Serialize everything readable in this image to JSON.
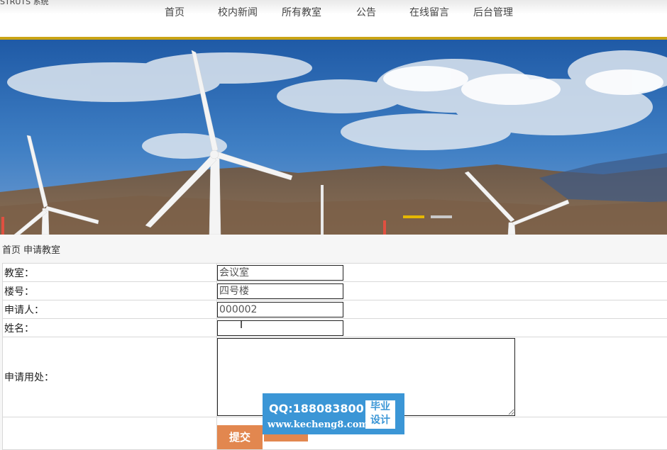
{
  "header": {
    "top_left_text": "STRUTS 系统",
    "nav": [
      "首页",
      "校内新闻",
      "所有教室",
      "公告",
      "在线留言",
      "后台管理"
    ]
  },
  "breadcrumb": [
    "首页",
    "申请教室"
  ],
  "form": {
    "rows": [
      {
        "label": "教室：",
        "value": "会议室"
      },
      {
        "label": "楼号：",
        "value": "四号楼"
      },
      {
        "label": "申请人：",
        "value": "000002"
      },
      {
        "label": "姓名：",
        "value": ""
      }
    ],
    "purpose_label": "申请用处：",
    "purpose_value": "",
    "submit_label": "提交"
  },
  "watermark": {
    "qq": "QQ:188083800",
    "url": "www.kecheng8.com",
    "badge_line1": "毕业",
    "badge_line2": "设计"
  },
  "colors": {
    "accent": "#c9a416",
    "button": "#e2874f",
    "watermark": "#3b96d6"
  }
}
